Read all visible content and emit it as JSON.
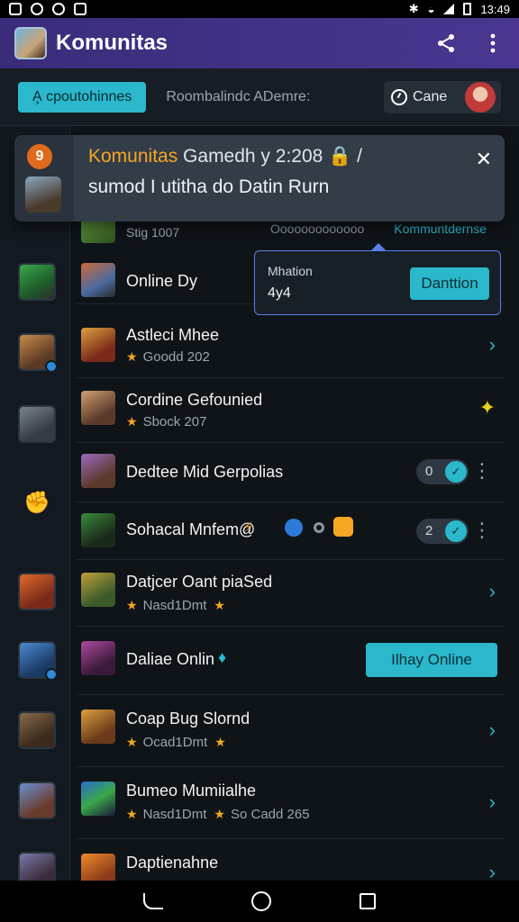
{
  "status_bar": {
    "time": "13:49"
  },
  "app_bar": {
    "title": "Komunitas"
  },
  "filter_row": {
    "active_chip": "A̧ cpoutohinnes",
    "secondary_text": "Roombalindc ADemre:",
    "user_label": "Cane"
  },
  "banner": {
    "badge_text": "9",
    "title_highlight": "Komunitas",
    "title_rest": " Gamedh y 2:208 🔒 /",
    "body": "sumod I utitha do Datin Rurn"
  },
  "partial_row": {
    "sub": "Stig 1007",
    "mid": "Ooooooooooooo",
    "right": "Kommuntdernse"
  },
  "popup": {
    "label": "Mhation",
    "value": "4y4",
    "button": "Danttion"
  },
  "rows": [
    {
      "name": "Online Dy"
    },
    {
      "name": "Astleci Mhee",
      "sub": "Goodd 202"
    },
    {
      "name": "Cordine Gefounied",
      "sub": "Sbock 207"
    },
    {
      "name": "Dedtee Mid Gerpolias",
      "toggle_value": "0"
    },
    {
      "name": "Sohacal Mnfem@",
      "toggle_value": "2"
    },
    {
      "name": "Datjcer Oant piaSed",
      "sub": "Nasd1Dmt"
    },
    {
      "name": "Daliae Onlin",
      "button": "Ilhay Online"
    },
    {
      "name": "Coap Bug Slornd",
      "sub": "Ocad1Dmt"
    },
    {
      "name": "Bumeo Mumiialhe",
      "sub": "Nasd1Dmt",
      "sub2": "So Cadd 265"
    },
    {
      "name": "Daptienahne"
    }
  ],
  "icons": [
    "share-icon",
    "more-vert-icon",
    "clock-icon",
    "close-icon",
    "chevron-right-icon",
    "star-icon",
    "lightning-icon"
  ],
  "colors": {
    "accent": "#2bb7cc",
    "appbar": "#3a2c7a",
    "highlight": "#f5a623",
    "background": "#0f1419"
  }
}
